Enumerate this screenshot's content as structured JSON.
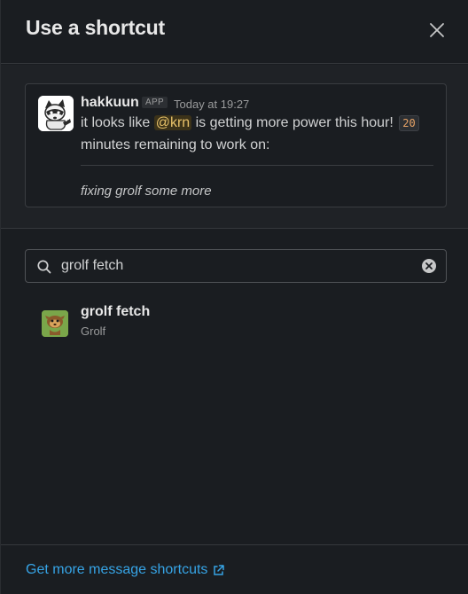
{
  "header": {
    "title": "Use a shortcut"
  },
  "message": {
    "sender": "hakkuun",
    "badge": "APP",
    "timestamp": "Today at 19:27",
    "text_before": "it looks like",
    "mention": "@krn",
    "text_after": "is getting more power this hour!",
    "code": "20",
    "text_line2": "minutes remaining to work on:",
    "italic": "fixing grolf some more"
  },
  "search": {
    "value": "grolf fetch",
    "placeholder": "Search"
  },
  "results": [
    {
      "name": "grolf fetch",
      "subtitle": "Grolf",
      "icon": "grolf-app-icon"
    }
  ],
  "footer": {
    "link_label": "Get more message shortcuts"
  },
  "colors": {
    "accent_link": "#36a4e6",
    "mention": "#e8c26a",
    "code": "#e8a366",
    "background": "#1a1d21"
  }
}
